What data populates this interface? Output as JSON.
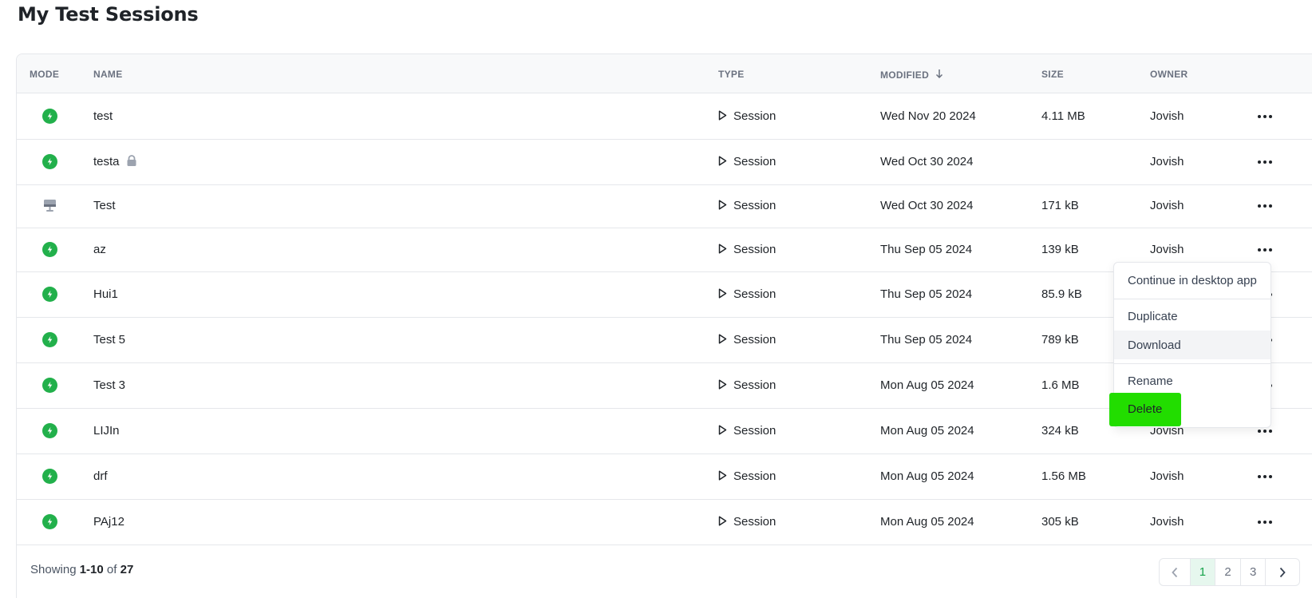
{
  "page_title": "My Test Sessions",
  "table": {
    "headers": {
      "mode": "MODE",
      "name": "NAME",
      "type": "TYPE",
      "modified": "MODIFIED",
      "size": "SIZE",
      "owner": "OWNER"
    },
    "sort_icon": "arrow-down-icon",
    "rows": [
      {
        "mode": "bolt-icon",
        "name": "test",
        "locked": false,
        "type": "Session",
        "modified": "Wed Nov 20 2024",
        "size": "4.11 MB",
        "owner": "Jovish"
      },
      {
        "mode": "bolt-icon",
        "name": "testa",
        "locked": true,
        "type": "Session",
        "modified": "Wed Oct 30 2024",
        "size": "",
        "owner": "Jovish"
      },
      {
        "mode": "desktop-icon",
        "name": "Test",
        "locked": false,
        "type": "Session",
        "modified": "Wed Oct 30 2024",
        "size": "171 kB",
        "owner": "Jovish"
      },
      {
        "mode": "bolt-icon",
        "name": "az",
        "locked": false,
        "type": "Session",
        "modified": "Thu Sep 05 2024",
        "size": "139 kB",
        "owner": "Jovish"
      },
      {
        "mode": "bolt-icon",
        "name": "Hui1",
        "locked": false,
        "type": "Session",
        "modified": "Thu Sep 05 2024",
        "size": "85.9 kB",
        "owner": ""
      },
      {
        "mode": "bolt-icon",
        "name": "Test 5",
        "locked": false,
        "type": "Session",
        "modified": "Thu Sep 05 2024",
        "size": "789 kB",
        "owner": ""
      },
      {
        "mode": "bolt-icon",
        "name": "Test 3",
        "locked": false,
        "type": "Session",
        "modified": "Mon Aug 05 2024",
        "size": "1.6 MB",
        "owner": ""
      },
      {
        "mode": "bolt-icon",
        "name": "LIJIn",
        "locked": false,
        "type": "Session",
        "modified": "Mon Aug 05 2024",
        "size": "324 kB",
        "owner": "Jovish"
      },
      {
        "mode": "bolt-icon",
        "name": "drf",
        "locked": false,
        "type": "Session",
        "modified": "Mon Aug 05 2024",
        "size": "1.56 MB",
        "owner": "Jovish"
      },
      {
        "mode": "bolt-icon",
        "name": "PAj12",
        "locked": false,
        "type": "Session",
        "modified": "Mon Aug 05 2024",
        "size": "305 kB",
        "owner": "Jovish"
      }
    ]
  },
  "context_menu": {
    "items": {
      "continue_desktop": "Continue in desktop app",
      "duplicate": "Duplicate",
      "download": "Download",
      "rename": "Rename",
      "delete": "Delete"
    },
    "hovered": "Download",
    "highlight_color": "#22dd00"
  },
  "footer": {
    "showing_prefix": "Showing",
    "range": "1-10",
    "of": "of",
    "total": "27"
  },
  "pagination": {
    "pages": [
      "1",
      "2",
      "3"
    ],
    "current": "1",
    "prev_icon": "chevron-left-icon",
    "next_icon": "chevron-right-icon"
  },
  "colors": {
    "mode_green": "#22b04b",
    "active_page_bg": "#e6f7ee",
    "active_page_text": "#16a34a"
  }
}
